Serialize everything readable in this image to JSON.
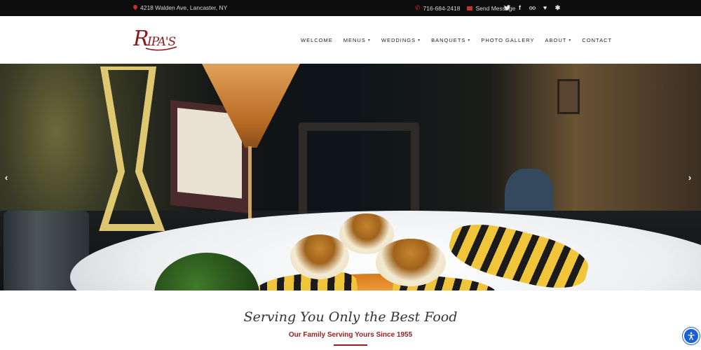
{
  "topbar": {
    "address": "4218 Walden Ave, Lancaster, NY",
    "phone": "716-684-2418",
    "message": "Send Message",
    "social_icons": [
      "twitter-icon",
      "facebook-icon",
      "tripadvisor-icon",
      "heart-icon",
      "yelp-icon"
    ]
  },
  "header": {
    "logo_text": "RIPA'S",
    "nav": [
      {
        "label": "WELCOME",
        "dropdown": false
      },
      {
        "label": "MENUS",
        "dropdown": true
      },
      {
        "label": "WEDDINGS",
        "dropdown": true
      },
      {
        "label": "BANQUETS",
        "dropdown": true
      },
      {
        "label": "PHOTO GALLERY",
        "dropdown": false
      },
      {
        "label": "ABOUT",
        "dropdown": true
      },
      {
        "label": "CONTACT",
        "dropdown": false
      }
    ]
  },
  "hero": {
    "prev_icon": "chevron-left-icon",
    "next_icon": "chevron-right-icon"
  },
  "intro": {
    "tagline": "Serving You Only the Best Food",
    "subline": "Our Family Serving Yours Since 1955"
  },
  "accessibility": {
    "icon": "accessibility-icon"
  },
  "colors": {
    "topbar_bg": "#0d0d0d",
    "accent_red": "#9b1c1c",
    "logo_red": "#8b1a1a",
    "a11y_blue": "#1b5fd6"
  }
}
